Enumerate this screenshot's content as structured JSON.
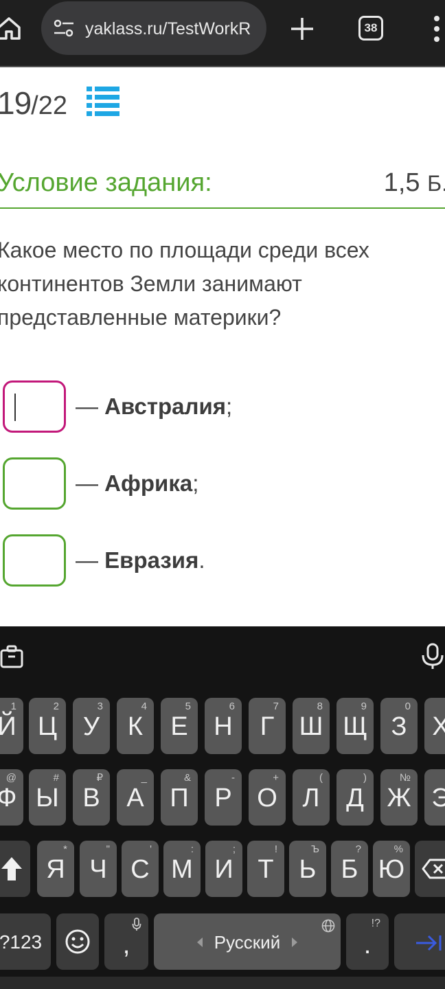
{
  "browser": {
    "url": "yaklass.ru/TestWorkR",
    "tab_count": "38",
    "icons": [
      "home-icon",
      "site-settings-icon",
      "new-tab-plus-icon",
      "tab-switcher-icon",
      "overflow-menu-icon"
    ]
  },
  "test": {
    "current": "19",
    "total": "/22",
    "condition_title": "Условие задания:",
    "points": "1,5",
    "points_unit": "Б."
  },
  "question": {
    "text": "Какое место по площади среди всех континентов Земли занимают представленные материки?"
  },
  "answers": [
    {
      "prefix": "— ",
      "name": "Австралия",
      "suffix": ";",
      "value": ""
    },
    {
      "prefix": "— ",
      "name": "Африка",
      "suffix": ";",
      "value": ""
    },
    {
      "prefix": "— ",
      "name": "Евразия",
      "suffix": ".",
      "value": ""
    }
  ],
  "colors": {
    "accent_green": "#55a630",
    "focus_magenta": "#c2187a",
    "keyboard_bg": "#141414",
    "key_bg": "#575757"
  },
  "keyboard": {
    "row1": [
      {
        "key": "Й",
        "hint": "1"
      },
      {
        "key": "Ц",
        "hint": "2"
      },
      {
        "key": "У",
        "hint": "3"
      },
      {
        "key": "К",
        "hint": "4"
      },
      {
        "key": "Е",
        "hint": "5"
      },
      {
        "key": "Н",
        "hint": "6"
      },
      {
        "key": "Г",
        "hint": "7"
      },
      {
        "key": "Ш",
        "hint": "8"
      },
      {
        "key": "Щ",
        "hint": "9"
      },
      {
        "key": "З",
        "hint": "0"
      },
      {
        "key": "Х",
        "hint": ""
      }
    ],
    "row2": [
      {
        "key": "Ф",
        "hint": "@"
      },
      {
        "key": "Ы",
        "hint": "#"
      },
      {
        "key": "В",
        "hint": "₽"
      },
      {
        "key": "А",
        "hint": "_"
      },
      {
        "key": "П",
        "hint": "&"
      },
      {
        "key": "Р",
        "hint": "-"
      },
      {
        "key": "О",
        "hint": "+"
      },
      {
        "key": "Л",
        "hint": "("
      },
      {
        "key": "Д",
        "hint": ")"
      },
      {
        "key": "Ж",
        "hint": "№"
      },
      {
        "key": "Э",
        "hint": ""
      }
    ],
    "row3": [
      {
        "key": "Я",
        "hint": "*"
      },
      {
        "key": "Ч",
        "hint": "\""
      },
      {
        "key": "С",
        "hint": "'"
      },
      {
        "key": "М",
        "hint": ":"
      },
      {
        "key": "И",
        "hint": ";"
      },
      {
        "key": "Т",
        "hint": "!"
      },
      {
        "key": "Ь",
        "hint": "Ъ"
      },
      {
        "key": "Б",
        "hint": "?"
      },
      {
        "key": "Ю",
        "hint": "%"
      }
    ],
    "symbols_label": "?123",
    "comma": ",",
    "space_label": "Русский",
    "period": ".",
    "period_hint": "!?",
    "icons": [
      "clipboard-icon",
      "microphone-icon",
      "shift-icon",
      "backspace-icon",
      "emoji-icon",
      "globe-icon",
      "enter-next-icon"
    ]
  }
}
